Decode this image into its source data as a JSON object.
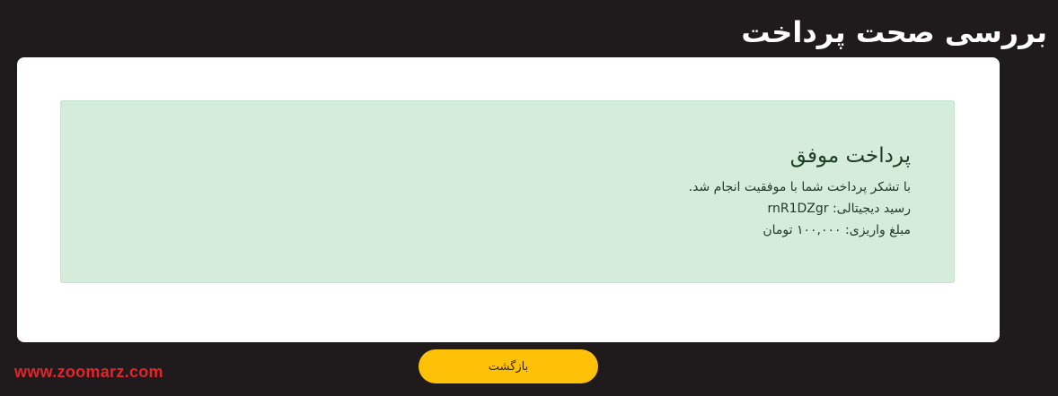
{
  "page": {
    "title": "بررسی صحت پرداخت"
  },
  "alert": {
    "heading": "پرداخت موفق",
    "message": "با تشکر پرداخت شما با موفقیت انجام شد.",
    "receipt": "رسید دیجیتالی: rnR1DZgr",
    "amount": "مبلغ واریزی: ۱۰۰,۰۰۰ تومان"
  },
  "actions": {
    "back_label": "بازگشت"
  },
  "watermark": {
    "text": "www.zoomarz.com"
  },
  "colors": {
    "background": "#1f1a1b",
    "card": "#ffffff",
    "alert_bg": "#d5ecdb",
    "alert_text": "#1f4127",
    "button": "#ffc107",
    "watermark": "#e3242b"
  }
}
